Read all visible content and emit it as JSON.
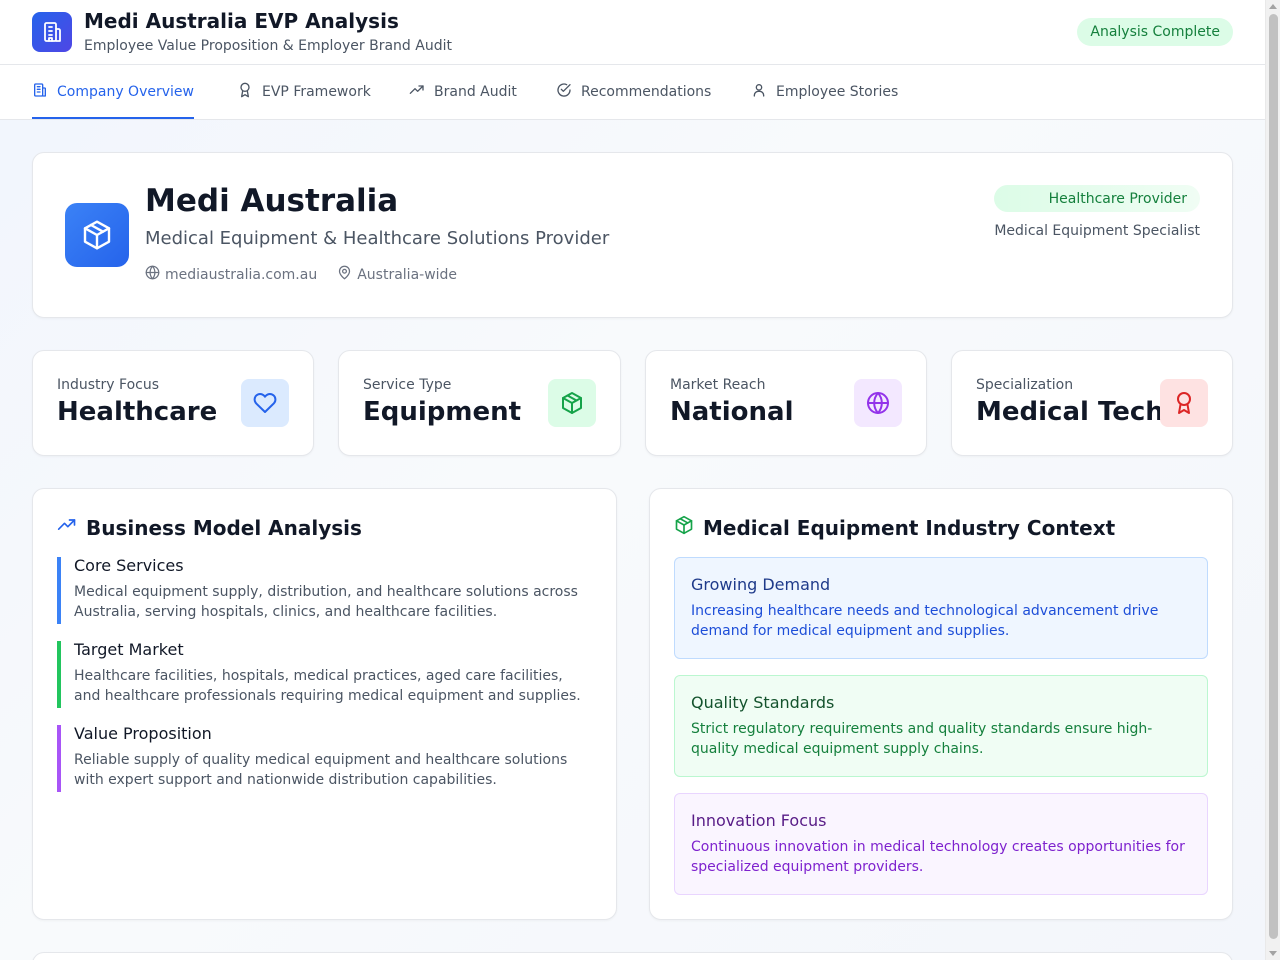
{
  "header": {
    "title": "Medi Australia EVP Analysis",
    "subtitle": "Employee Value Proposition & Employer Brand Audit",
    "status": "Analysis Complete"
  },
  "tabs": [
    {
      "label": "Company Overview",
      "icon": "building-icon",
      "active": true
    },
    {
      "label": "EVP Framework",
      "icon": "award-icon",
      "active": false
    },
    {
      "label": "Brand Audit",
      "icon": "trending-up-icon",
      "active": false
    },
    {
      "label": "Recommendations",
      "icon": "check-circle-icon",
      "active": false
    },
    {
      "label": "Employee Stories",
      "icon": "user-icon",
      "active": false
    }
  ],
  "company": {
    "name": "Medi Australia",
    "description": "Medical Equipment & Healthcare Solutions Provider",
    "website": "mediaustralia.com.au",
    "location": "Australia-wide",
    "badge": "Healthcare Provider",
    "badge_sub": "Medical Equipment Specialist"
  },
  "stats": [
    {
      "label": "Industry Focus",
      "value": "Healthcare",
      "icon": "heart-icon",
      "color": "#2563eb",
      "bg": "#dbeafe"
    },
    {
      "label": "Service Type",
      "value": "Equipment",
      "icon": "package-icon",
      "color": "#16a34a",
      "bg": "#dcfce7"
    },
    {
      "label": "Market Reach",
      "value": "National",
      "icon": "globe-icon",
      "color": "#9333ea",
      "bg": "#f3e8ff"
    },
    {
      "label": "Specialization",
      "value": "Medical Tech",
      "icon": "award-icon",
      "color": "#dc2626",
      "bg": "#fee2e2"
    }
  ],
  "business_model": {
    "title": "Business Model Analysis",
    "items": [
      {
        "heading": "Core Services",
        "text": "Medical equipment supply, distribution, and healthcare solutions across Australia, serving hospitals, clinics, and healthcare facilities.",
        "color": "#3b82f6"
      },
      {
        "heading": "Target Market",
        "text": "Healthcare facilities, hospitals, medical practices, aged care facilities, and healthcare professionals requiring medical equipment and supplies.",
        "color": "#22c55e"
      },
      {
        "heading": "Value Proposition",
        "text": "Reliable supply of quality medical equipment and healthcare solutions with expert support and nationwide distribution capabilities.",
        "color": "#a855f7"
      }
    ]
  },
  "industry_context": {
    "title": "Medical Equipment Industry Context",
    "items": [
      {
        "heading": "Growing Demand",
        "text": "Increasing healthcare needs and technological advancement drive demand for medical equipment and supplies.",
        "bg": "#eff6ff",
        "border": "#bfdbfe",
        "head_color": "#1e3a8a",
        "text_color": "#1d4ed8"
      },
      {
        "heading": "Quality Standards",
        "text": "Strict regulatory requirements and quality standards ensure high-quality medical equipment supply chains.",
        "bg": "#f0fdf4",
        "border": "#bbf7d0",
        "head_color": "#14532d",
        "text_color": "#15803d"
      },
      {
        "heading": "Innovation Focus",
        "text": "Continuous innovation in medical technology creates opportunities for specialized equipment providers.",
        "bg": "#faf5ff",
        "border": "#e9d5ff",
        "head_color": "#581c87",
        "text_color": "#7e22ce"
      }
    ]
  }
}
